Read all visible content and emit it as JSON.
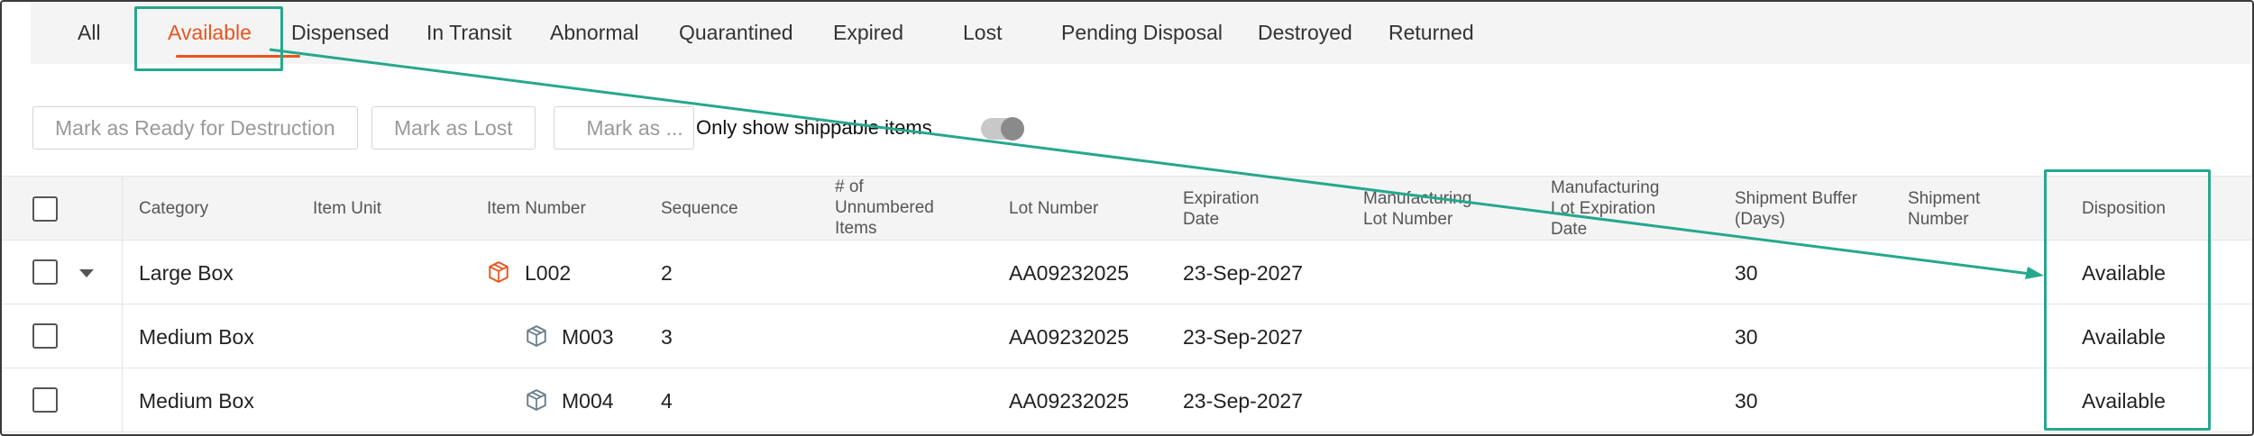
{
  "tabs": [
    {
      "id": "all",
      "label": "All"
    },
    {
      "id": "available",
      "label": "Available",
      "active": true
    },
    {
      "id": "dispensed",
      "label": "Dispensed"
    },
    {
      "id": "in-transit",
      "label": "In Transit"
    },
    {
      "id": "abnormal",
      "label": "Abnormal"
    },
    {
      "id": "quarantined",
      "label": "Quarantined"
    },
    {
      "id": "expired",
      "label": "Expired"
    },
    {
      "id": "lost",
      "label": "Lost"
    },
    {
      "id": "pending-disposal",
      "label": "Pending Disposal"
    },
    {
      "id": "destroyed",
      "label": "Destroyed"
    },
    {
      "id": "returned",
      "label": "Returned"
    }
  ],
  "toolbar": {
    "mark_destruction_label": "Mark as Ready for Destruction",
    "mark_lost_label": "Mark as Lost",
    "mark_as_label": "Mark as ...",
    "shippable_toggle_label": "Only show shippable items",
    "shippable_toggle_on": false
  },
  "table": {
    "headers": {
      "category": [
        "Category"
      ],
      "item_unit": [
        "Item Unit"
      ],
      "item_number": [
        "Item Number"
      ],
      "sequence": [
        "Sequence"
      ],
      "unnumbered": [
        "# of",
        "Unnumbered",
        "Items"
      ],
      "lot_number": [
        "Lot Number"
      ],
      "expiration": [
        "Expiration",
        "Date"
      ],
      "mfg_lot": [
        "Manufacturing",
        "Lot Number"
      ],
      "mfg_lot_exp": [
        "Manufacturing",
        "Lot Expiration",
        "Date"
      ],
      "buffer": [
        "Shipment Buffer",
        "(Days)"
      ],
      "shipment_number": [
        "Shipment",
        "Number"
      ],
      "disposition": [
        "Disposition"
      ]
    },
    "rows": [
      {
        "category": "Large Box",
        "item_number": "L002",
        "sequence": "2",
        "lot_number": "AA09232025",
        "expiration": "23-Sep-2027",
        "buffer": "30",
        "disposition": "Available",
        "icon": "box-orange-icon",
        "expandable": true
      },
      {
        "category": "Medium Box",
        "item_number": "M003",
        "sequence": "3",
        "lot_number": "AA09232025",
        "expiration": "23-Sep-2027",
        "buffer": "30",
        "disposition": "Available",
        "icon": "box-gray-icon",
        "expandable": false
      },
      {
        "category": "Medium Box",
        "item_number": "M004",
        "sequence": "4",
        "lot_number": "AA09232025",
        "expiration": "23-Sep-2027",
        "buffer": "30",
        "disposition": "Available",
        "icon": "box-gray-icon",
        "expandable": false
      }
    ]
  },
  "colors": {
    "accent": "#e8551d",
    "callout": "#25a88d",
    "header_bg": "#f4f4f5",
    "box_gray": "#6a7f8e"
  }
}
